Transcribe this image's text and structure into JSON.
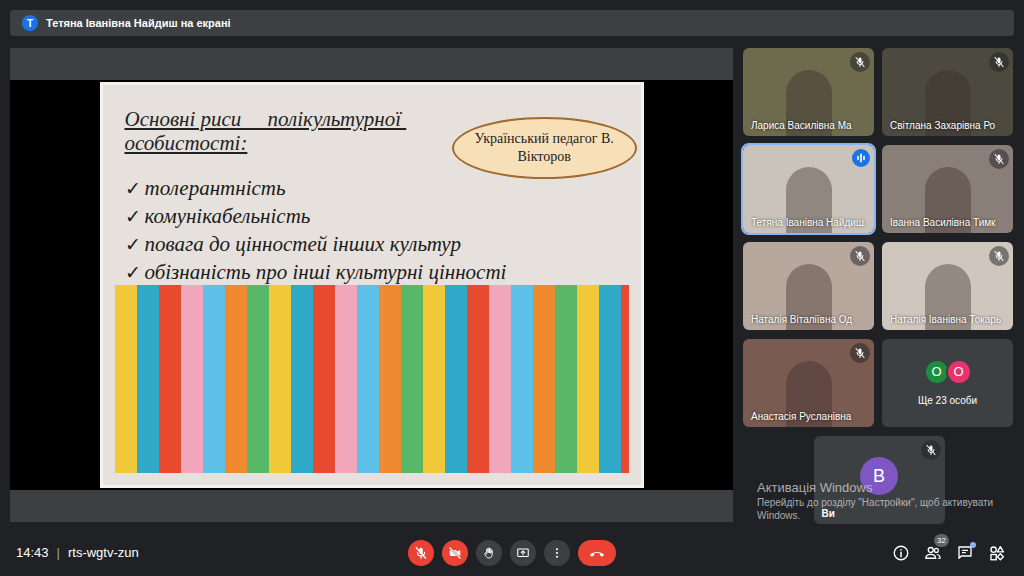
{
  "header": {
    "avatar": "Т",
    "title": "Тетяна Іванівна Найдиш на екрані"
  },
  "slide": {
    "title": "Основні риси     полікультурної особистості:",
    "author": "Український педагог В. Вікторов",
    "items": [
      {
        "check": "✓",
        "text": "толерантність"
      },
      {
        "check": "✓",
        "text": "комунікабельність"
      },
      {
        "check": "✓",
        "text": "повага до цінностей інших культур"
      },
      {
        "check": "✓",
        "text": "обізнаність про інші культурні цінності"
      }
    ]
  },
  "participants": [
    {
      "name": "Лариса Василівна Ма",
      "muted": true,
      "speaking": false
    },
    {
      "name": "Світлана Захарівна Ро",
      "muted": true,
      "speaking": false
    },
    {
      "name": "Тетяна Іванівна Найдиш",
      "muted": false,
      "speaking": true
    },
    {
      "name": "Іванна Василівна Тимк",
      "muted": true,
      "speaking": false
    },
    {
      "name": "Наталія Віталіївна Од",
      "muted": true,
      "speaking": false
    },
    {
      "name": "Наталія Іванівна Токарь",
      "muted": true,
      "speaking": false
    },
    {
      "name": "Анастасія Русланівна",
      "muted": true,
      "speaking": false
    }
  ],
  "more": {
    "avatars": [
      {
        "letter": "О",
        "color": "#1e8e3e"
      },
      {
        "letter": "О",
        "color": "#e8336d"
      }
    ],
    "label": "Ще 23 особи"
  },
  "self": {
    "avatar": "В",
    "name": "Ви",
    "muted": true
  },
  "watermark": {
    "title": "Активація Windows",
    "text": "Перейдіть до розділу \"Настройки\", щоб активувати Windows."
  },
  "footer": {
    "time": "14:43",
    "separator": "|",
    "code": "rts-wgtv-zun"
  },
  "controls": [
    {
      "kind": "mic",
      "off": true
    },
    {
      "kind": "camera",
      "off": true
    },
    {
      "kind": "hand",
      "off": false
    },
    {
      "kind": "present",
      "off": false
    },
    {
      "kind": "more",
      "off": false
    },
    {
      "kind": "leave",
      "off": false
    }
  ],
  "side": {
    "people_count": "32",
    "chat_unread": true
  }
}
